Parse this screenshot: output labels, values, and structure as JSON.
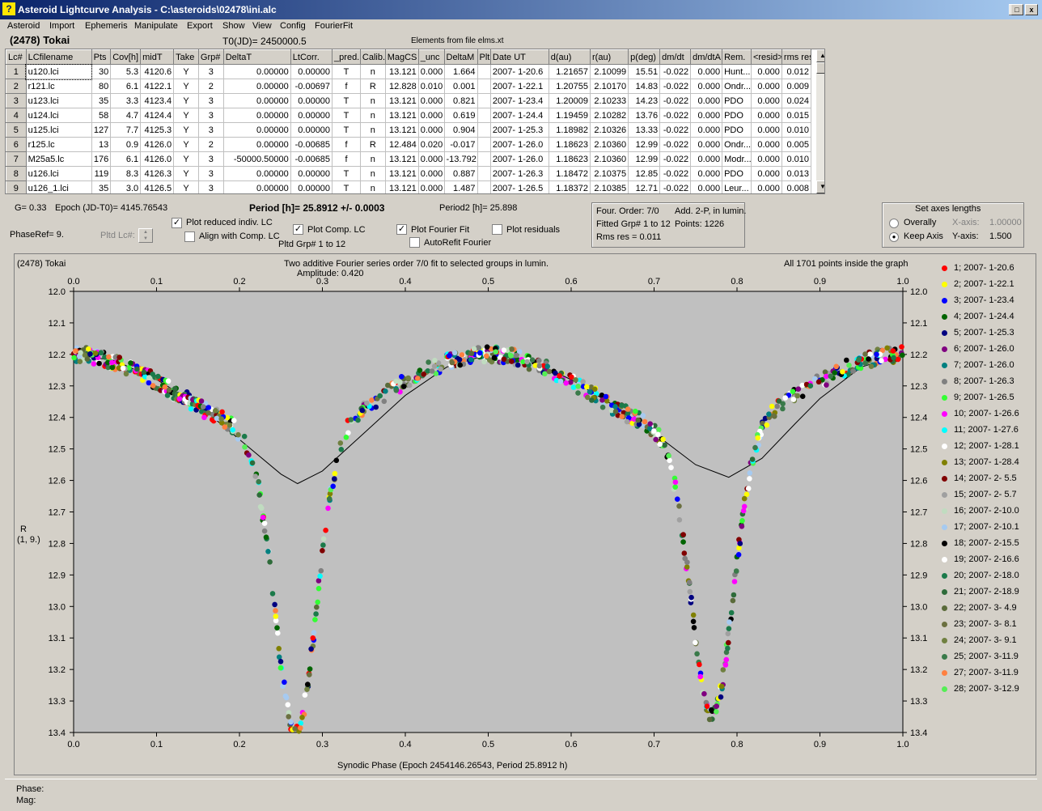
{
  "window": {
    "title": "Asteroid Lightcurve Analysis - C:\\asteroids\\02478\\ini.alc",
    "icon": "app-icon",
    "controls": [
      "_",
      "□",
      "x"
    ]
  },
  "menu": [
    "Asteroid",
    "Import",
    "Ephemeris",
    "Manipulate",
    "Export",
    "Show",
    "View",
    "Config",
    "FourierFit"
  ],
  "header": {
    "asteroid": "(2478) Tokai",
    "t0": "T0(JD)= 2450000.5",
    "elements": "Elements from file elms.xt"
  },
  "table": {
    "columns": [
      "Lc#",
      "LCfilename",
      "Pts",
      "Cov[h]",
      "midT",
      "Take",
      "Grp#",
      "DeltaT",
      "LtCorr.",
      "_pred.",
      "Calib.",
      "MagCS",
      "_unc",
      "DeltaM",
      "Plt",
      "Date UT",
      "d(au)",
      "r(au)",
      "p(deg)",
      "dm/dt",
      "dm/dtA",
      "Rem.",
      "<resid>",
      "rms res"
    ],
    "rows": [
      [
        "1",
        "u120.lci",
        "30",
        "5.3",
        "4120.6",
        "Y",
        "3",
        "0.00000",
        "0.00000",
        "T",
        "n",
        "13.121",
        "0.000",
        "1.664",
        "",
        "2007- 1-20.6",
        "1.21657",
        "2.10099",
        "15.51",
        "-0.022",
        "0.000",
        "Hunt...",
        "0.000",
        "0.012"
      ],
      [
        "2",
        "r121.lc",
        "80",
        "6.1",
        "4122.1",
        "Y",
        "2",
        "0.00000",
        "-0.00697",
        "f",
        "R",
        "12.828",
        "0.010",
        "0.001",
        "",
        "2007- 1-22.1",
        "1.20755",
        "2.10170",
        "14.83",
        "-0.022",
        "0.000",
        "Ondr...",
        "0.000",
        "0.009"
      ],
      [
        "3",
        "u123.lci",
        "35",
        "3.3",
        "4123.4",
        "Y",
        "3",
        "0.00000",
        "0.00000",
        "T",
        "n",
        "13.121",
        "0.000",
        "0.821",
        "",
        "2007- 1-23.4",
        "1.20009",
        "2.10233",
        "14.23",
        "-0.022",
        "0.000",
        "PDO",
        "0.000",
        "0.024"
      ],
      [
        "4",
        "u124.lci",
        "58",
        "4.7",
        "4124.4",
        "Y",
        "3",
        "0.00000",
        "0.00000",
        "T",
        "n",
        "13.121",
        "0.000",
        "0.619",
        "",
        "2007- 1-24.4",
        "1.19459",
        "2.10282",
        "13.76",
        "-0.022",
        "0.000",
        "PDO",
        "0.000",
        "0.015"
      ],
      [
        "5",
        "u125.lci",
        "127",
        "7.7",
        "4125.3",
        "Y",
        "3",
        "0.00000",
        "0.00000",
        "T",
        "n",
        "13.121",
        "0.000",
        "0.904",
        "",
        "2007- 1-25.3",
        "1.18982",
        "2.10326",
        "13.33",
        "-0.022",
        "0.000",
        "PDO",
        "0.000",
        "0.010"
      ],
      [
        "6",
        "r125.lc",
        "13",
        "0.9",
        "4126.0",
        "Y",
        "2",
        "0.00000",
        "-0.00685",
        "f",
        "R",
        "12.484",
        "0.020",
        "-0.017",
        "",
        "2007- 1-26.0",
        "1.18623",
        "2.10360",
        "12.99",
        "-0.022",
        "0.000",
        "Ondr...",
        "0.000",
        "0.005"
      ],
      [
        "7",
        "M25a5.lc",
        "176",
        "6.1",
        "4126.0",
        "Y",
        "3",
        "-50000.50000",
        "-0.00685",
        "f",
        "n",
        "13.121",
        "0.000",
        "-13.792",
        "",
        "2007- 1-26.0",
        "1.18623",
        "2.10360",
        "12.99",
        "-0.022",
        "0.000",
        "Modr...",
        "0.000",
        "0.010"
      ],
      [
        "8",
        "u126.lci",
        "119",
        "8.3",
        "4126.3",
        "Y",
        "3",
        "0.00000",
        "0.00000",
        "T",
        "n",
        "13.121",
        "0.000",
        "0.887",
        "",
        "2007- 1-26.3",
        "1.18472",
        "2.10375",
        "12.85",
        "-0.022",
        "0.000",
        "PDO",
        "0.000",
        "0.013"
      ],
      [
        "9",
        "u126_1.lci",
        "35",
        "3.0",
        "4126.5",
        "Y",
        "3",
        "0.00000",
        "0.00000",
        "T",
        "n",
        "13.121",
        "0.000",
        "1.487",
        "",
        "2007- 1-26.5",
        "1.18372",
        "2.10385",
        "12.71",
        "-0.022",
        "0.000",
        "Leur...",
        "0.000",
        "0.008"
      ]
    ]
  },
  "controls": {
    "g": "G= 0.33",
    "epoch": "Epoch (JD-T0)= 4145.76543",
    "period": "Period [h]= 25.8912 +/- 0.0003",
    "period2": "Period2 [h]= 25.898",
    "phaseref": "PhaseRef= 9.",
    "pltd_lc": "Pltd Lc#:",
    "plot_reduced": "Plot reduced indiv. LC",
    "align_comp": "Align with Comp. LC",
    "plot_comp": "Plot Comp. LC",
    "pltd_grp": "Pltd Grp#  1   to   12",
    "plot_fourier": "Plot Fourier Fit",
    "autorefit": "AutoRefit Fourier",
    "plot_residuals": "Plot residuals",
    "check_reduced": true,
    "check_align": false,
    "check_comp": true,
    "check_fourier": true,
    "check_autorefit": false,
    "check_residuals": false
  },
  "fitinfo": {
    "line1a": "Four. Order:  7/0",
    "line1b": "Add. 2-P, in lumin.",
    "line2a": "Fitted Grp# 1 to 12",
    "line2b": "Points: 1226",
    "line3": "Rms res     = 0.011"
  },
  "axes_box": {
    "title": "Set axes lengths",
    "overally": "Overally",
    "keep_axis": "Keep Axis",
    "x_axis_label": "X-axis:",
    "x_axis_value": "1.00000",
    "y_axis_label": "Y-axis:",
    "y_axis_value": "1.500",
    "selected": "keep_axis"
  },
  "graph": {
    "name": "(2478) Tokai",
    "subtitle": "Two additive Fourier series order 7/0 fit to selected groups in lumin.",
    "amplitude": "Amplitude: 0.420",
    "points_note": "All 1701 points inside the graph",
    "ylabel": "R",
    "ylabel2": "(1, 9.)",
    "xlabel": "Synodic Phase (Epoch 2454146.26543, Period 25.8912 h)"
  },
  "chart_data": {
    "type": "scatter",
    "x_range": [
      0.0,
      1.0
    ],
    "y_range": [
      12.0,
      13.4
    ],
    "y_inverted": true,
    "x_ticks": [
      "0.0",
      "0.1",
      "0.2",
      "0.3",
      "0.4",
      "0.5",
      "0.6",
      "0.7",
      "0.8",
      "0.9",
      "1.0"
    ],
    "y_ticks": [
      "12.0",
      "12.1",
      "12.2",
      "12.3",
      "12.4",
      "12.5",
      "12.6",
      "12.7",
      "12.8",
      "12.9",
      "13.0",
      "13.1",
      "13.2",
      "13.3",
      "13.4"
    ],
    "fourier_fit": {
      "x": [
        0.0,
        0.05,
        0.1,
        0.15,
        0.2,
        0.25,
        0.27,
        0.3,
        0.35,
        0.4,
        0.45,
        0.5,
        0.55,
        0.6,
        0.65,
        0.7,
        0.75,
        0.79,
        0.83,
        0.87,
        0.9,
        0.95,
        1.0
      ],
      "y": [
        12.2,
        12.22,
        12.28,
        12.36,
        12.47,
        12.58,
        12.61,
        12.57,
        12.45,
        12.33,
        12.24,
        12.2,
        12.22,
        12.28,
        12.36,
        12.45,
        12.55,
        12.59,
        12.53,
        12.42,
        12.34,
        12.24,
        12.2
      ]
    },
    "legend_position": "right",
    "series": [
      {
        "name": "1; 2007- 1-20.6",
        "color": "#ff0000"
      },
      {
        "name": "2; 2007- 1-22.1",
        "color": "#ffff00"
      },
      {
        "name": "3; 2007- 1-23.4",
        "color": "#0000ff"
      },
      {
        "name": "4; 2007- 1-24.4",
        "color": "#006400"
      },
      {
        "name": "5; 2007- 1-25.3",
        "color": "#000080"
      },
      {
        "name": "6; 2007- 1-26.0",
        "color": "#800080"
      },
      {
        "name": "7; 2007- 1-26.0",
        "color": "#008080"
      },
      {
        "name": "8; 2007- 1-26.3",
        "color": "#808080"
      },
      {
        "name": "9; 2007- 1-26.5",
        "color": "#33ff33"
      },
      {
        "name": "10; 2007- 1-26.6",
        "color": "#ff00ff"
      },
      {
        "name": "11; 2007- 1-27.6",
        "color": "#00ffff"
      },
      {
        "name": "12; 2007- 1-28.1",
        "color": "#ffffff"
      },
      {
        "name": "13; 2007- 1-28.4",
        "color": "#808000"
      },
      {
        "name": "14; 2007- 2- 5.5",
        "color": "#800000"
      },
      {
        "name": "15; 2007- 2- 5.7",
        "color": "#a0a0a0"
      },
      {
        "name": "16; 2007- 2-10.0",
        "color": "#c0dcc0"
      },
      {
        "name": "17; 2007- 2-10.1",
        "color": "#a6caf0"
      },
      {
        "name": "18; 2007- 2-15.5",
        "color": "#000000"
      },
      {
        "name": "19; 2007- 2-16.6",
        "color": "#ffffff"
      },
      {
        "name": "20; 2007- 2-18.0",
        "color": "#1b7a4a"
      },
      {
        "name": "21; 2007- 2-18.9",
        "color": "#2e6b3a"
      },
      {
        "name": "22; 2007- 3- 4.9",
        "color": "#5a6b3a"
      },
      {
        "name": "23; 2007- 3- 8.1",
        "color": "#6b7040"
      },
      {
        "name": "24; 2007- 3- 9.1",
        "color": "#708040"
      },
      {
        "name": "25; 2007- 3-11.9",
        "color": "#3a7a4a"
      },
      {
        "name": "27; 2007- 3-11.9",
        "color": "#ff8040"
      },
      {
        "name": "28; 2007- 3-12.9",
        "color": "#55ee55"
      }
    ]
  },
  "status": {
    "phase": "Phase:",
    "mag": "Mag:"
  }
}
